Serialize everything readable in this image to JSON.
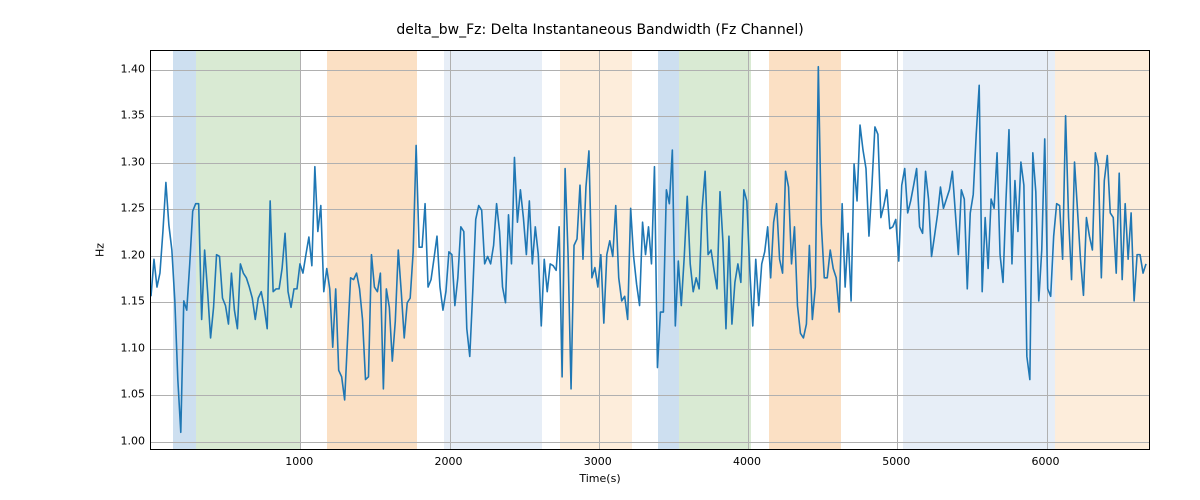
{
  "chart_data": {
    "type": "line",
    "title": "delta_bw_Fz: Delta Instantaneous Bandwidth (Fz Channel)",
    "xlabel": "Time(s)",
    "ylabel": "Hz",
    "xlim": [
      0,
      6700
    ],
    "ylim": [
      0.99,
      1.42
    ],
    "xticks": [
      1000,
      2000,
      3000,
      4000,
      5000,
      6000
    ],
    "yticks": [
      1.0,
      1.05,
      1.1,
      1.15,
      1.2,
      1.25,
      1.3,
      1.35,
      1.4
    ],
    "bands": [
      {
        "x0": 150,
        "x1": 300,
        "color": "#cddff0"
      },
      {
        "x0": 300,
        "x1": 1000,
        "color": "#d9ead3"
      },
      {
        "x0": 1180,
        "x1": 1780,
        "color": "#fbe0c4"
      },
      {
        "x0": 1960,
        "x1": 2140,
        "color": "#e7eef7"
      },
      {
        "x0": 2140,
        "x1": 2620,
        "color": "#e7eef7"
      },
      {
        "x0": 2740,
        "x1": 3220,
        "color": "#fdeddb"
      },
      {
        "x0": 3400,
        "x1": 3540,
        "color": "#cddff0"
      },
      {
        "x0": 3540,
        "x1": 4020,
        "color": "#d9ead3"
      },
      {
        "x0": 4140,
        "x1": 4620,
        "color": "#fbe0c4"
      },
      {
        "x0": 5040,
        "x1": 6060,
        "color": "#e7eef7"
      },
      {
        "x0": 6060,
        "x1": 6700,
        "color": "#fdeddb"
      }
    ],
    "series": [
      {
        "name": "delta_bw_Fz",
        "color": "#1f77b4",
        "x_start": 0,
        "x_step": 20,
        "values": [
          1.155,
          1.195,
          1.165,
          1.18,
          1.225,
          1.278,
          1.232,
          1.205,
          1.15,
          1.065,
          1.008,
          1.15,
          1.14,
          1.19,
          1.247,
          1.255,
          1.255,
          1.13,
          1.205,
          1.16,
          1.11,
          1.143,
          1.2,
          1.198,
          1.153,
          1.145,
          1.125,
          1.18,
          1.14,
          1.12,
          1.19,
          1.18,
          1.175,
          1.165,
          1.153,
          1.13,
          1.153,
          1.16,
          1.143,
          1.12,
          1.258,
          1.16,
          1.163,
          1.163,
          1.185,
          1.223,
          1.16,
          1.143,
          1.163,
          1.163,
          1.19,
          1.18,
          1.2,
          1.219,
          1.188,
          1.295,
          1.225,
          1.253,
          1.16,
          1.185,
          1.163,
          1.1,
          1.163,
          1.075,
          1.068,
          1.043,
          1.11,
          1.175,
          1.173,
          1.18,
          1.163,
          1.13,
          1.065,
          1.068,
          1.2,
          1.165,
          1.16,
          1.18,
          1.055,
          1.163,
          1.143,
          1.085,
          1.128,
          1.205,
          1.16,
          1.11,
          1.148,
          1.153,
          1.203,
          1.318,
          1.208,
          1.208,
          1.255,
          1.165,
          1.173,
          1.196,
          1.22,
          1.165,
          1.14,
          1.16,
          1.203,
          1.2,
          1.145,
          1.175,
          1.23,
          1.225,
          1.12,
          1.09,
          1.16,
          1.238,
          1.253,
          1.248,
          1.19,
          1.198,
          1.19,
          1.21,
          1.255,
          1.225,
          1.165,
          1.148,
          1.243,
          1.19,
          1.305,
          1.235,
          1.27,
          1.24,
          1.2,
          1.258,
          1.19,
          1.23,
          1.2,
          1.123,
          1.195,
          1.16,
          1.19,
          1.188,
          1.183,
          1.23,
          1.068,
          1.293,
          1.2,
          1.055,
          1.21,
          1.217,
          1.275,
          1.195,
          1.273,
          1.312,
          1.175,
          1.186,
          1.165,
          1.2,
          1.126,
          1.2,
          1.215,
          1.198,
          1.253,
          1.175,
          1.15,
          1.155,
          1.13,
          1.25,
          1.198,
          1.168,
          1.145,
          1.235,
          1.2,
          1.23,
          1.19,
          1.295,
          1.078,
          1.138,
          1.138,
          1.27,
          1.255,
          1.313,
          1.123,
          1.193,
          1.145,
          1.198,
          1.263,
          1.19,
          1.16,
          1.175,
          1.163,
          1.25,
          1.29,
          1.2,
          1.205,
          1.183,
          1.163,
          1.268,
          1.213,
          1.12,
          1.22,
          1.125,
          1.17,
          1.19,
          1.17,
          1.27,
          1.258,
          1.183,
          1.123,
          1.195,
          1.145,
          1.19,
          1.203,
          1.23,
          1.175,
          1.235,
          1.255,
          1.195,
          1.18,
          1.29,
          1.273,
          1.19,
          1.23,
          1.145,
          1.115,
          1.11,
          1.125,
          1.21,
          1.13,
          1.165,
          1.403,
          1.233,
          1.175,
          1.175,
          1.205,
          1.185,
          1.175,
          1.138,
          1.255,
          1.165,
          1.223,
          1.15,
          1.298,
          1.258,
          1.34,
          1.313,
          1.293,
          1.22,
          1.275,
          1.338,
          1.33,
          1.24,
          1.253,
          1.27,
          1.228,
          1.23,
          1.238,
          1.193,
          1.275,
          1.293,
          1.245,
          1.258,
          1.275,
          1.293,
          1.23,
          1.223,
          1.29,
          1.26,
          1.198,
          1.22,
          1.243,
          1.273,
          1.25,
          1.26,
          1.27,
          1.29,
          1.245,
          1.2,
          1.27,
          1.26,
          1.163,
          1.245,
          1.265,
          1.33,
          1.383,
          1.16,
          1.24,
          1.185,
          1.26,
          1.25,
          1.31,
          1.2,
          1.17,
          1.26,
          1.335,
          1.19,
          1.28,
          1.225,
          1.3,
          1.275,
          1.09,
          1.065,
          1.31,
          1.268,
          1.15,
          1.205,
          1.325,
          1.163,
          1.155,
          1.22,
          1.255,
          1.253,
          1.195,
          1.35,
          1.24,
          1.173,
          1.3,
          1.248,
          1.195,
          1.156,
          1.24,
          1.22,
          1.205,
          1.31,
          1.295,
          1.175,
          1.28,
          1.307,
          1.245,
          1.24,
          1.18,
          1.288,
          1.173,
          1.255,
          1.195,
          1.245,
          1.15,
          1.2,
          1.2,
          1.18,
          1.19
        ]
      }
    ]
  }
}
